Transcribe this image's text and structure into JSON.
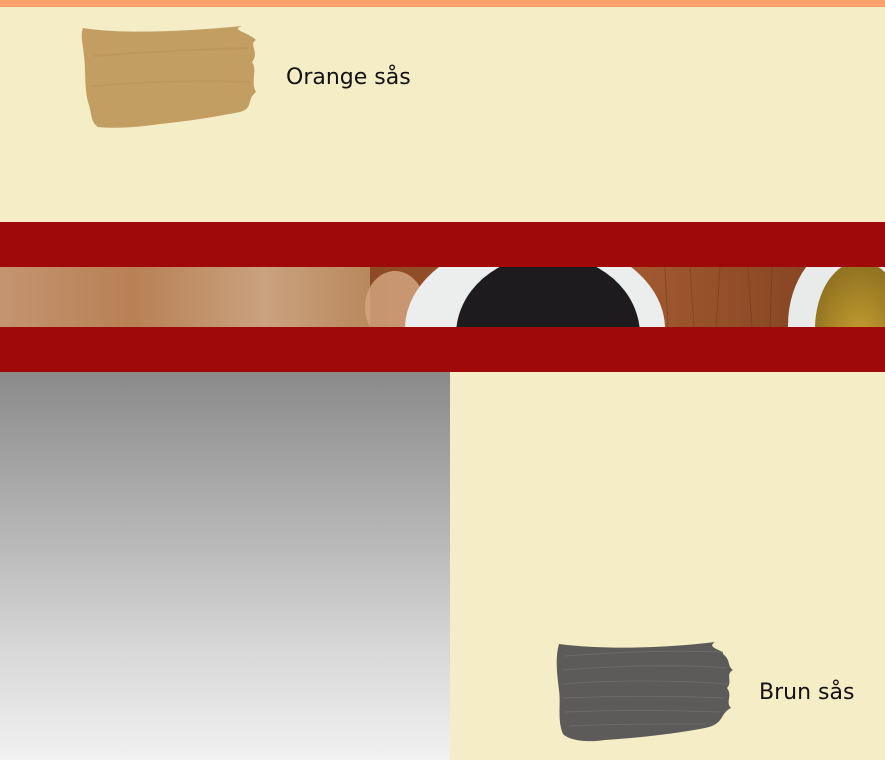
{
  "colors": {
    "background": "#f5edc6",
    "top_accent": "#ffa16b",
    "banner": "#a00909",
    "orange_swatch": "#c29e63",
    "brown_swatch": "#5d5b59"
  },
  "swatches": [
    {
      "label": "Orange sås",
      "icon": "orange-paint-stroke-icon"
    },
    {
      "label": "Brun sås",
      "icon": "brown-paint-stroke-icon"
    }
  ],
  "banner": {
    "image": "coffee-cups-on-wooden-table-photo"
  }
}
